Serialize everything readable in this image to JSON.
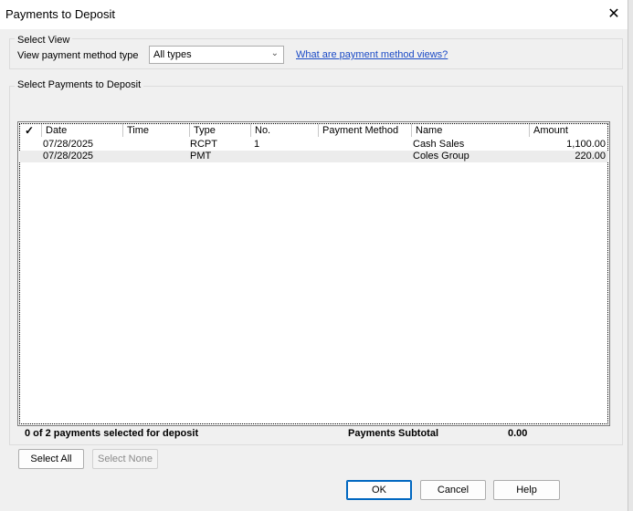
{
  "window": {
    "title": "Payments to Deposit"
  },
  "select_view": {
    "group_label": "Select View",
    "label": "View payment method type",
    "selected": "All types",
    "help_link": "What are payment method views?"
  },
  "payments": {
    "group_label": "Select Payments to Deposit",
    "columns": [
      "✓",
      "Date",
      "Time",
      "Type",
      "No.",
      "Payment Method",
      "Name",
      "Amount"
    ],
    "rows": [
      {
        "date": "07/28/2025",
        "time": "",
        "type": "RCPT",
        "no": "1",
        "method": "",
        "name": "Cash Sales",
        "amount": "1,100.00"
      },
      {
        "date": "07/28/2025",
        "time": "",
        "type": "PMT",
        "no": "",
        "method": "",
        "name": "Coles Group",
        "amount": "220.00"
      }
    ],
    "selected_count_text": "0 of 2 payments selected for deposit",
    "subtotal_label": "Payments Subtotal",
    "subtotal_value": "0.00"
  },
  "buttons": {
    "select_all": "Select All",
    "select_none": "Select None",
    "ok": "OK",
    "cancel": "Cancel",
    "help": "Help"
  }
}
